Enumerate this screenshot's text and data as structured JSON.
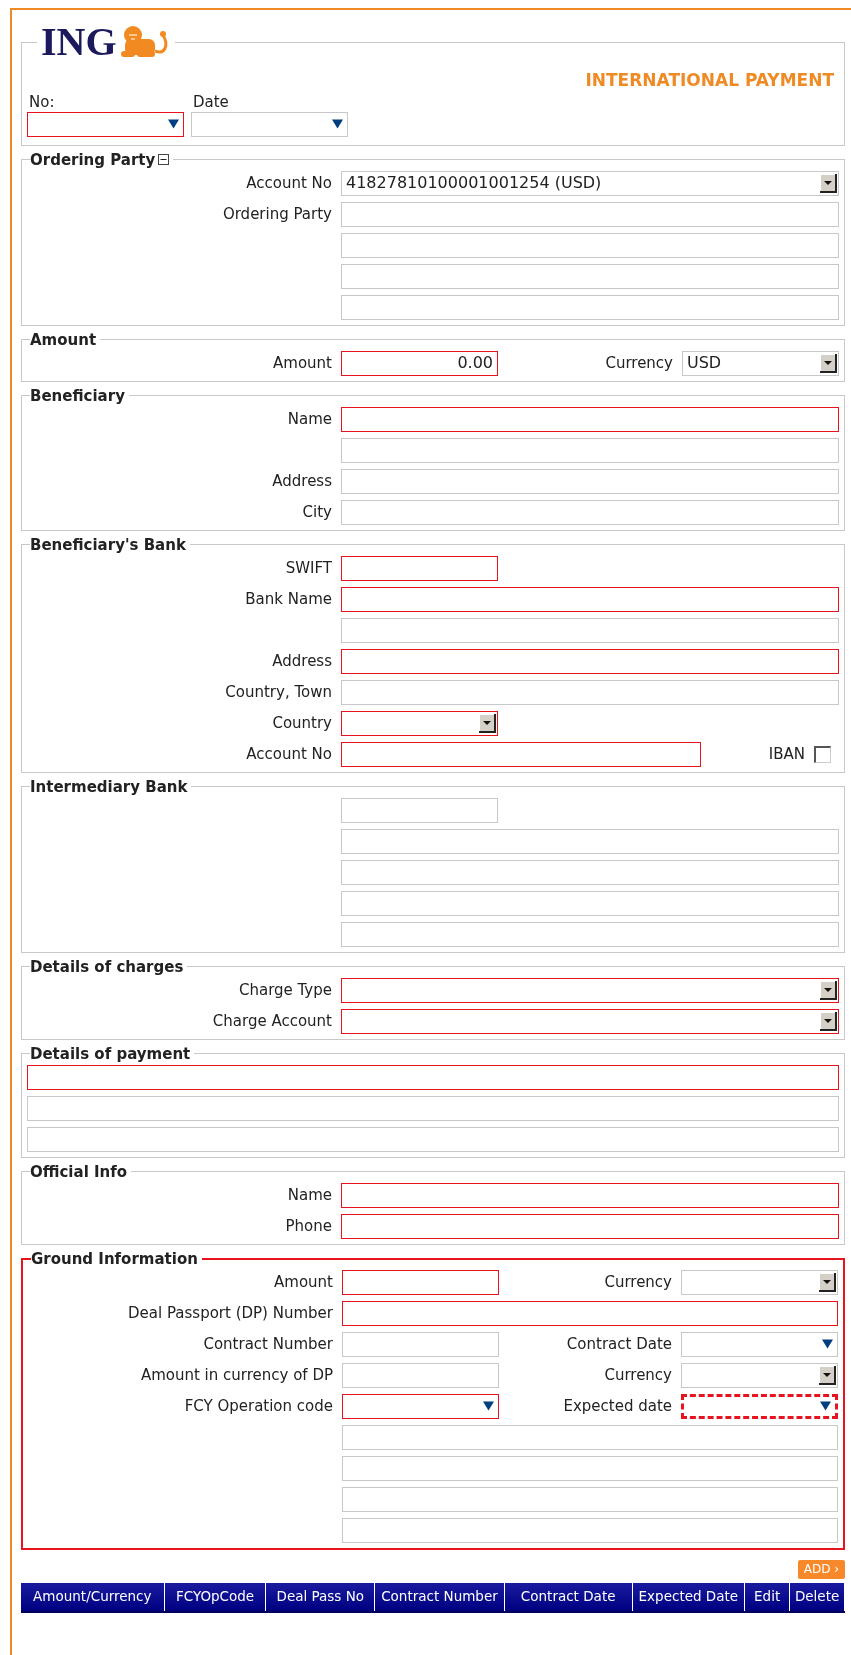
{
  "header": {
    "logo_text": "ING",
    "title": "INTERNATIONAL PAYMENT",
    "fields": [
      {
        "label": "No:",
        "kind": "short_dropdown",
        "required": true
      },
      {
        "label": "Date",
        "kind": "short_dropdown",
        "required": false
      }
    ]
  },
  "sections": [
    {
      "title": "Ordering Party",
      "expanded": true,
      "required": false,
      "kind": "form",
      "rows": [
        {
          "label": "Account No",
          "fields": [
            {
              "kind": "select",
              "required": false,
              "value": "41827810100001001254 (USD)"
            }
          ]
        },
        {
          "label": "Ordering Party",
          "fields": [
            {
              "kind": "text",
              "required": false
            }
          ]
        },
        {
          "fields": [
            {
              "kind": "text",
              "required": false
            }
          ]
        },
        {
          "fields": [
            {
              "kind": "text",
              "required": false
            }
          ]
        },
        {
          "fields": [
            {
              "kind": "text",
              "required": false
            }
          ]
        }
      ]
    },
    {
      "title": "Amount",
      "required": false,
      "kind": "form",
      "rows": [
        {
          "label": "Amount",
          "fields": [
            {
              "kind": "amount_text",
              "required": true,
              "value": "0.00"
            }
          ],
          "side": {
            "label": "Currency",
            "field": {
              "kind": "short_select",
              "required": false,
              "value": "USD"
            }
          }
        }
      ]
    },
    {
      "title": "Beneficiary",
      "required": false,
      "kind": "form",
      "rows": [
        {
          "label": "Name",
          "fields": [
            {
              "kind": "text",
              "required": true
            }
          ]
        },
        {
          "fields": [
            {
              "kind": "text",
              "required": false
            }
          ]
        },
        {
          "label": "Address",
          "fields": [
            {
              "kind": "text",
              "required": false
            }
          ]
        },
        {
          "label": "City",
          "fields": [
            {
              "kind": "text",
              "required": false
            }
          ]
        }
      ]
    },
    {
      "title": "Beneficiary's Bank",
      "required": false,
      "kind": "form",
      "rows": [
        {
          "label": "SWIFT",
          "fields": [
            {
              "kind": "short_text",
              "required": true
            }
          ]
        },
        {
          "label": "Bank Name",
          "fields": [
            {
              "kind": "text",
              "required": true
            }
          ]
        },
        {
          "fields": [
            {
              "kind": "text",
              "required": false
            }
          ]
        },
        {
          "label": "Address",
          "fields": [
            {
              "kind": "text",
              "required": true
            }
          ]
        },
        {
          "label": "Country, Town",
          "fields": [
            {
              "kind": "text",
              "required": false
            }
          ]
        },
        {
          "label": "Country",
          "fields": [
            {
              "kind": "short_select",
              "required": true
            }
          ]
        },
        {
          "label": "Account No",
          "fields": [
            {
              "kind": "medium_text",
              "required": true
            }
          ],
          "side": {
            "label": "IBAN",
            "field": {
              "kind": "checkbox",
              "checked": false
            }
          }
        }
      ]
    },
    {
      "title": "Intermediary Bank",
      "required": false,
      "kind": "form",
      "rows": [
        {
          "fields": [
            {
              "kind": "short_text",
              "required": false
            }
          ]
        },
        {
          "fields": [
            {
              "kind": "text",
              "required": false
            }
          ]
        },
        {
          "fields": [
            {
              "kind": "text",
              "required": false
            }
          ]
        },
        {
          "fields": [
            {
              "kind": "text",
              "required": false
            }
          ]
        },
        {
          "fields": [
            {
              "kind": "text",
              "required": false
            }
          ]
        }
      ]
    },
    {
      "title": "Details of charges",
      "required": false,
      "kind": "form",
      "rows": [
        {
          "label": "Charge Type",
          "fields": [
            {
              "kind": "select",
              "required": true
            }
          ]
        },
        {
          "label": "Charge Account",
          "fields": [
            {
              "kind": "select",
              "required": true
            }
          ]
        }
      ]
    },
    {
      "title": "Details of payment",
      "required": false,
      "kind": "wide",
      "rows": [
        {
          "fields": [
            {
              "kind": "text",
              "required": true
            }
          ]
        },
        {
          "fields": [
            {
              "kind": "text",
              "required": false
            }
          ]
        },
        {
          "fields": [
            {
              "kind": "text",
              "required": false
            }
          ]
        }
      ]
    },
    {
      "title": "Official Info",
      "required": false,
      "kind": "form",
      "rows": [
        {
          "label": "Name",
          "fields": [
            {
              "kind": "text",
              "required": true
            }
          ]
        },
        {
          "label": "Phone",
          "fields": [
            {
              "kind": "text",
              "required": true
            }
          ]
        }
      ]
    },
    {
      "title": "Ground Information",
      "required": true,
      "kind": "form",
      "rows": [
        {
          "label": "Amount",
          "fields": [
            {
              "kind": "short_text",
              "required": true
            }
          ],
          "side": {
            "label": "Currency",
            "field": {
              "kind": "short_select",
              "required": false
            }
          }
        },
        {
          "label": "Deal Passport (DP) Number",
          "fields": [
            {
              "kind": "text",
              "required": true
            }
          ]
        },
        {
          "label": "Contract Number",
          "fields": [
            {
              "kind": "short_text",
              "required": false
            }
          ],
          "side": {
            "label": "Contract Date",
            "field": {
              "kind": "short_dropdown",
              "required": false
            }
          }
        },
        {
          "label": "Amount in currency of DP",
          "fields": [
            {
              "kind": "short_text",
              "required": false
            }
          ],
          "side": {
            "label": "Currency",
            "field": {
              "kind": "short_select",
              "required": false
            }
          }
        },
        {
          "label": "FCY Operation code",
          "fields": [
            {
              "kind": "short_dropdown",
              "required": true
            }
          ],
          "side": {
            "label": "Expected date",
            "field": {
              "kind": "short_dropdown",
              "required": true,
              "focused": true
            }
          }
        },
        {
          "fields": [
            {
              "kind": "text",
              "required": false
            }
          ]
        },
        {
          "fields": [
            {
              "kind": "text",
              "required": false
            }
          ]
        },
        {
          "fields": [
            {
              "kind": "text",
              "required": false
            }
          ]
        },
        {
          "fields": [
            {
              "kind": "text",
              "required": false
            }
          ]
        }
      ]
    }
  ],
  "add_button": "ADD ›",
  "table": {
    "columns": [
      "Amount/Currency",
      "FCYOpCode",
      "Deal Pass No",
      "Contract Number",
      "Contract Date",
      "Expected Date",
      "Edit",
      "Delete"
    ]
  }
}
